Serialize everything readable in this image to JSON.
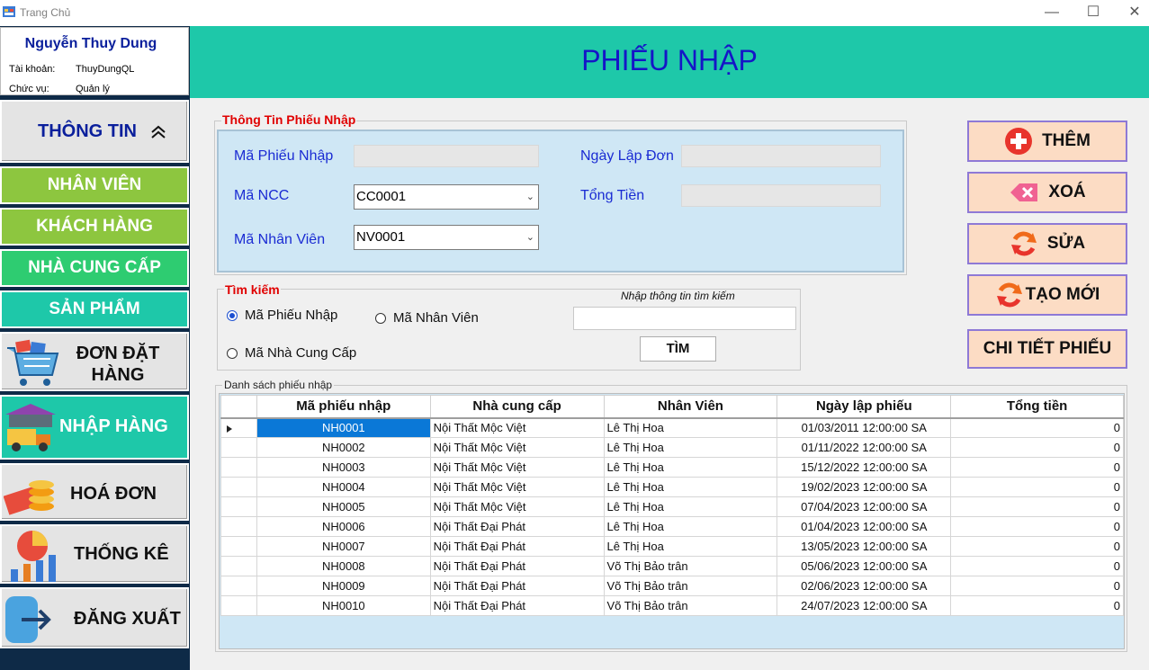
{
  "window": {
    "title": "Trang Chủ",
    "minimize": "—",
    "maximize": "☐",
    "close": "✕"
  },
  "user": {
    "name": "Nguyễn Thuy Dung",
    "account_label": "Tài khoản:",
    "account": "ThuyDungQL",
    "role_label": "Chức vụ:",
    "role": "Quản lý"
  },
  "nav": {
    "info": "THÔNG TIN",
    "staff": "NHÂN VIÊN",
    "customers": "KHÁCH HÀNG",
    "suppliers": "NHÀ CUNG CẤP",
    "products": "SẢN PHẨM",
    "orders": "ĐƠN ĐẶT HÀNG",
    "imports": "NHẬP HÀNG",
    "invoices": "HOÁ ĐƠN",
    "stats": "THỐNG KÊ",
    "logout": "ĐĂNG XUẤT"
  },
  "colors": {
    "header": "#1ec8a9",
    "title": "#1515c7",
    "sidebar": "#0e2a47",
    "staff": "#8dc63f",
    "customers": "#8dc63f",
    "suppliers": "#2ecc71",
    "products": "#1ec8a9",
    "imports": "#1ec8a9",
    "action_bg": "#fcdcc4"
  },
  "page_title": "PHIẾU NHẬP",
  "form": {
    "legend": "Thông Tin Phiếu Nhập",
    "ma_phieu_label": "Mã Phiếu Nhập",
    "ma_phieu_value": "",
    "ngay_lap_label": "Ngày Lập Đơn",
    "ngay_lap_value": "",
    "ma_ncc_label": "Mã NCC",
    "ma_ncc_value": "CC0001",
    "tong_tien_label": "Tổng Tiền",
    "tong_tien_value": "",
    "ma_nv_label": "Mã Nhân Viên",
    "ma_nv_value": "NV0001"
  },
  "search": {
    "legend": "Tìm kiếm",
    "opt_ma_phieu": "Mã Phiếu Nhập",
    "opt_ma_nv": "Mã Nhân Viên",
    "opt_ma_ncc": "Mã Nhà Cung Cấp",
    "selected": "opt_ma_phieu",
    "hint": "Nhập thông tin tìm kiếm",
    "query": "",
    "button": "TÌM"
  },
  "actions": {
    "add": "THÊM",
    "delete": "XOÁ",
    "edit": "SỬA",
    "new": "TẠO MỚI",
    "detail": "CHI TIẾT PHIẾU"
  },
  "list": {
    "legend": "Danh sách phiếu nhập",
    "columns": [
      "Mã phiếu nhập",
      "Nhà cung cấp",
      "Nhân Viên",
      "Ngày lập phiếu",
      "Tổng tiền"
    ],
    "rows": [
      [
        "NH0001",
        "Nội Thất Mộc Việt",
        "Lê Thị Hoa",
        "01/03/2011 12:00:00 SA",
        "0"
      ],
      [
        "NH0002",
        "Nội Thất Mộc Việt",
        "Lê Thị Hoa",
        "01/11/2022 12:00:00 SA",
        "0"
      ],
      [
        "NH0003",
        "Nội Thất Mộc Việt",
        "Lê Thị Hoa",
        "15/12/2022 12:00:00 SA",
        "0"
      ],
      [
        "NH0004",
        "Nội Thất Mộc Việt",
        "Lê Thị Hoa",
        "19/02/2023 12:00:00 SA",
        "0"
      ],
      [
        "NH0005",
        "Nội Thất Mộc Việt",
        "Lê Thị Hoa",
        "07/04/2023 12:00:00 SA",
        "0"
      ],
      [
        "NH0006",
        "Nội Thất Đại Phát",
        "Lê Thị Hoa",
        "01/04/2023 12:00:00 SA",
        "0"
      ],
      [
        "NH0007",
        "Nội Thất Đại Phát",
        "Lê Thị Hoa",
        "13/05/2023 12:00:00 SA",
        "0"
      ],
      [
        "NH0008",
        "Nội Thất Đại Phát",
        "Võ Thị Bảo trân",
        "05/06/2023 12:00:00 SA",
        "0"
      ],
      [
        "NH0009",
        "Nội Thất Đại Phát",
        "Võ Thị Bảo trân",
        "02/06/2023 12:00:00 SA",
        "0"
      ],
      [
        "NH0010",
        "Nội Thất Đại Phát",
        "Võ Thị Bảo trân",
        "24/07/2023 12:00:00 SA",
        "0"
      ]
    ],
    "selected_row": 0
  }
}
